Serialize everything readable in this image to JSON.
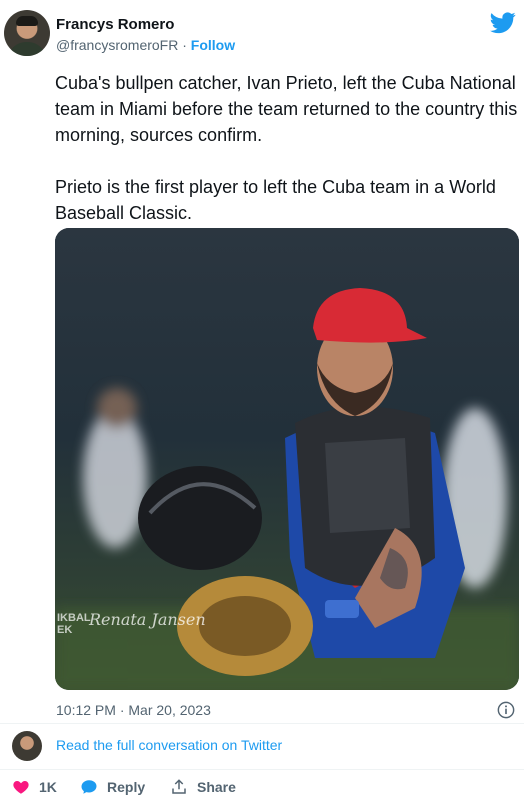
{
  "author": {
    "name": "Francys Romero",
    "handle": "@francysromeroFR",
    "separator": "·",
    "follow_label": "Follow"
  },
  "tweet": {
    "paragraph1": "Cuba's bullpen catcher, Ivan Prieto, left the Cuba National team in Miami before the team returned to the country this morning, sources confirm.",
    "paragraph2": "Prieto is the first player to left the Cuba team in a World Baseball Classic.",
    "timestamp": "10:12 PM · Mar 20, 2023"
  },
  "photo": {
    "watermark_left": "IKBAL\nEK",
    "watermark_script": "Renata Jansen"
  },
  "conversation": {
    "link_label": "Read the full conversation on Twitter"
  },
  "actions": {
    "like_count": "1K",
    "reply_label": "Reply",
    "share_label": "Share"
  },
  "icons": {
    "brand": "twitter-bird-icon",
    "info": "info-icon",
    "like": "heart-icon",
    "reply": "speech-bubble-icon",
    "share": "share-upload-icon"
  },
  "colors": {
    "accent": "#1d9bf0",
    "like": "#f91880",
    "muted": "#536471"
  }
}
